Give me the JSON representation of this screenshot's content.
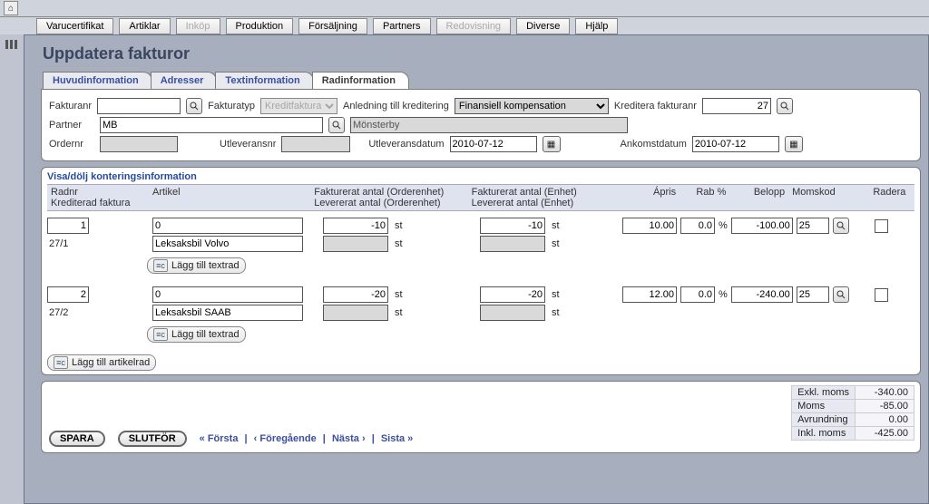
{
  "menu": {
    "items": [
      "Varucertifikat",
      "Artiklar",
      "Inköp",
      "Produktion",
      "Försäljning",
      "Partners",
      "Redovisning",
      "Diverse",
      "Hjälp"
    ],
    "disabled": [
      2,
      6
    ]
  },
  "page": {
    "title": "Uppdatera fakturor"
  },
  "tabs": {
    "items": [
      "Huvudinformation",
      "Adresser",
      "Textinformation",
      "Radinformation"
    ],
    "active": 3
  },
  "head": {
    "fakturanr_label": "Fakturanr",
    "fakturanr": "",
    "fakturatyp_label": "Fakturatyp",
    "fakturatyp": "Kreditfaktura",
    "anledning_label": "Anledning till kreditering",
    "anledning": "Finansiell kompensation",
    "krediteranr_label": "Kreditera fakturanr",
    "krediteranr": "27",
    "partner_label": "Partner",
    "partner_code": "MB",
    "partner_name": "Mönsterby",
    "ordernr_label": "Ordernr",
    "ordernr": "",
    "utlevnr_label": "Utleveransnr",
    "utlevnr": "",
    "utlevdatum_label": "Utleveransdatum",
    "utlevdatum": "2010-07-12",
    "ankomst_label": "Ankomstdatum",
    "ankomst": "2010-07-12"
  },
  "grid": {
    "section": "Visa/dölj konteringsinformation",
    "h_radnr": "Radnr",
    "h_kred": "Krediterad faktura",
    "h_art": "Artikel",
    "h_qo1": "Fakturerat antal (Orderenhet)",
    "h_qo2": "Levererat antal (Orderenhet)",
    "h_qu1": "Fakturerat antal (Enhet)",
    "h_qu2": "Levererat antal (Enhet)",
    "h_aprice": "Ápris",
    "h_rab": "Rab %",
    "h_bel": "Belopp",
    "h_moms": "Momskod",
    "h_del": "Radera",
    "rows": [
      {
        "radnr": "1",
        "kred": "27/1",
        "art_code": "0",
        "art_name": "Leksaksbil Volvo",
        "qo": "-10",
        "qo_unit": "st",
        "qo2": "",
        "qo2_unit": "st",
        "qu": "-10",
        "qu_unit": "st",
        "qu2": "",
        "qu2_unit": "st",
        "apris": "10.00",
        "rab": "0.0",
        "rab_suffix": "%",
        "belopp": "-100.00",
        "moms": "25",
        "addtext": "Lägg till textrad"
      },
      {
        "radnr": "2",
        "kred": "27/2",
        "art_code": "0",
        "art_name": "Leksaksbil SAAB",
        "qo": "-20",
        "qo_unit": "st",
        "qo2": "",
        "qo2_unit": "st",
        "qu": "-20",
        "qu_unit": "st",
        "qu2": "",
        "qu2_unit": "st",
        "apris": "12.00",
        "rab": "0.0",
        "rab_suffix": "%",
        "belopp": "-240.00",
        "moms": "25",
        "addtext": "Lägg till textrad"
      }
    ],
    "add_article": "Lägg till artikelrad"
  },
  "totals": {
    "exkl_l": "Exkl. moms",
    "exkl_v": "-340.00",
    "moms_l": "Moms",
    "moms_v": "-85.00",
    "avr_l": "Avrundning",
    "avr_v": "0.00",
    "inkl_l": "Inkl. moms",
    "inkl_v": "-425.00"
  },
  "footer": {
    "save": "SPARA",
    "finish": "SLUTFÖR",
    "first": "« Första",
    "prev": "‹ Föregående",
    "next": "Nästa ›",
    "last": "Sista »",
    "sep": "|"
  }
}
